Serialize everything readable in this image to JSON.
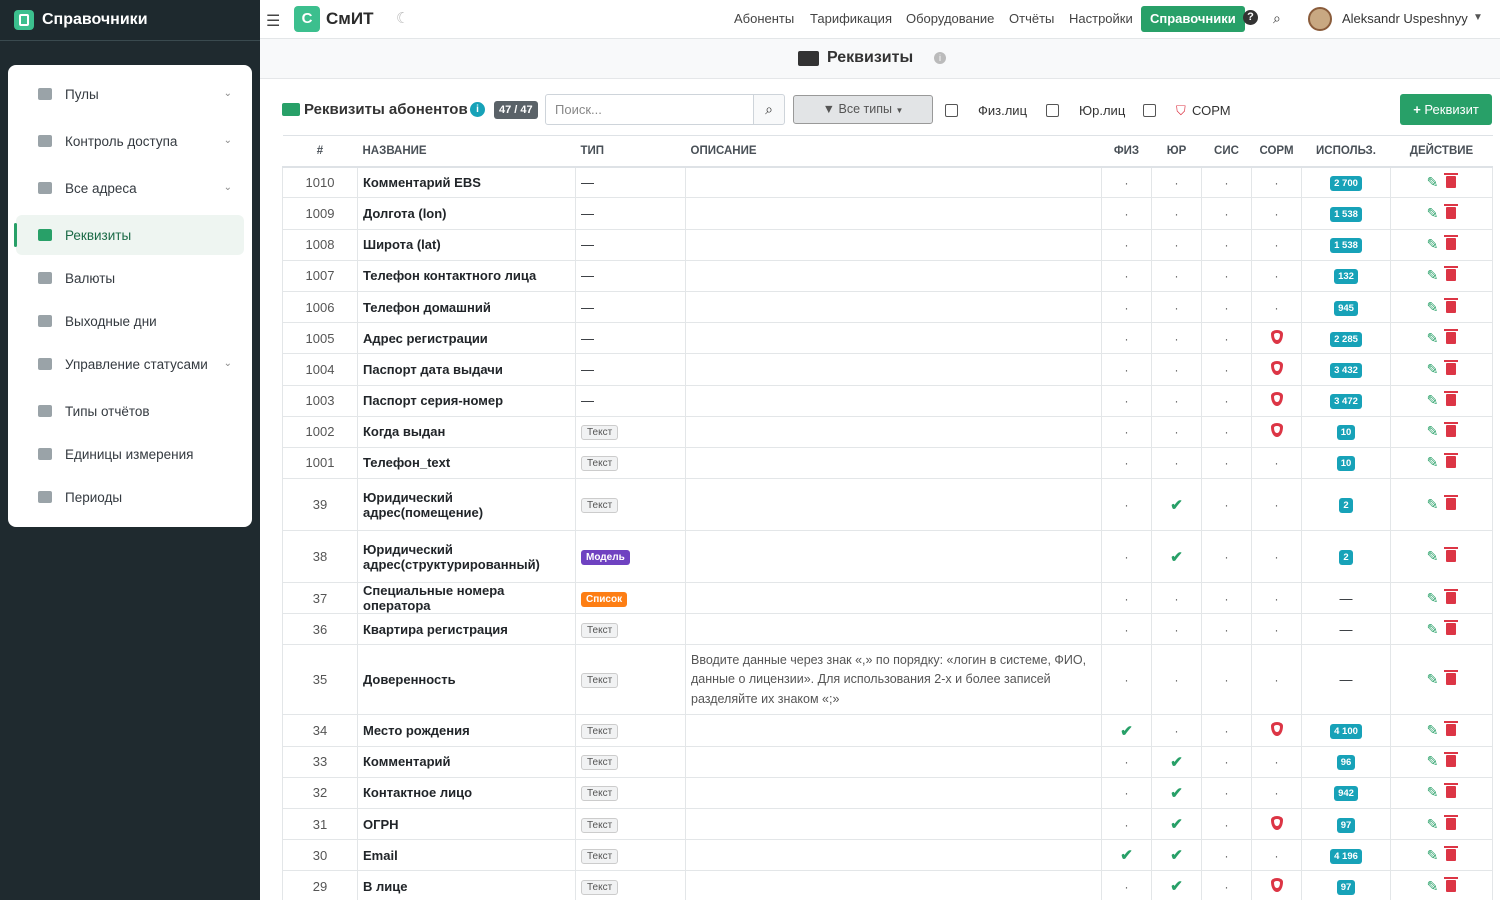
{
  "sidebar": {
    "brand": "Справочники",
    "items": [
      {
        "label": "Пулы",
        "caret": true,
        "active": false
      },
      {
        "label": "Контроль доступа",
        "caret": true,
        "active": false
      },
      {
        "label": "Все адреса",
        "caret": true,
        "active": false
      },
      {
        "label": "Реквизиты",
        "caret": false,
        "active": true
      },
      {
        "label": "Валюты",
        "caret": false,
        "active": false
      },
      {
        "label": "Выходные дни",
        "caret": false,
        "active": false
      },
      {
        "label": "Управление статусами",
        "caret": true,
        "active": false
      },
      {
        "label": "Типы отчётов",
        "caret": false,
        "active": false
      },
      {
        "label": "Единицы измерения",
        "caret": false,
        "active": false
      },
      {
        "label": "Периоды",
        "caret": false,
        "active": false
      }
    ]
  },
  "topbar": {
    "logo_letter": "С",
    "logo_text": "СмИТ",
    "nav": [
      "Абоненты",
      "Тарификация",
      "Оборудование",
      "Отчёты",
      "Настройки",
      "Справочники"
    ],
    "active_nav": "Справочники",
    "help": "?",
    "user": "Aleksandr Uspeshnyy"
  },
  "page": {
    "title": "Реквизиты",
    "info": "i"
  },
  "toolbar": {
    "title": "Реквизиты абонентов",
    "info": "i",
    "count": "47 / 47",
    "search_placeholder": "Поиск...",
    "filter_label": "Все типы",
    "cb_phys": "Физ.лиц",
    "cb_jur": "Юр.лиц",
    "cb_sorm": "СОРМ",
    "add_label": "Реквизит"
  },
  "table": {
    "headers": [
      "#",
      "НАЗВАНИЕ",
      "ТИП",
      "ОПИСАНИЕ",
      "ФИЗ",
      "ЮР",
      "СИС",
      "СОРМ",
      "ИСПОЛЬЗ.",
      "ДЕЙСТВИЕ"
    ],
    "rows": [
      {
        "id": "1010",
        "name": "Комментарий EBS",
        "type": "—",
        "desc": "",
        "fiz": "·",
        "jur": "·",
        "sis": "·",
        "sorm": "·",
        "used": "2 700"
      },
      {
        "id": "1009",
        "name": "Долгота (lon)",
        "type": "—",
        "desc": "",
        "fiz": "·",
        "jur": "·",
        "sis": "·",
        "sorm": "·",
        "used": "1 538"
      },
      {
        "id": "1008",
        "name": "Широта (lat)",
        "type": "—",
        "desc": "",
        "fiz": "·",
        "jur": "·",
        "sis": "·",
        "sorm": "·",
        "used": "1 538"
      },
      {
        "id": "1007",
        "name": "Телефон контактного лица",
        "type": "—",
        "desc": "",
        "fiz": "·",
        "jur": "·",
        "sis": "·",
        "sorm": "·",
        "used": "132"
      },
      {
        "id": "1006",
        "name": "Телефон домашний",
        "type": "—",
        "desc": "",
        "fiz": "·",
        "jur": "·",
        "sis": "·",
        "sorm": "·",
        "used": "945"
      },
      {
        "id": "1005",
        "name": "Адрес регистрации",
        "type": "—",
        "desc": "",
        "fiz": "·",
        "jur": "·",
        "sis": "·",
        "sorm": "shield",
        "used": "2 285"
      },
      {
        "id": "1004",
        "name": "Паспорт дата выдачи",
        "type": "—",
        "desc": "",
        "fiz": "·",
        "jur": "·",
        "sis": "·",
        "sorm": "shield",
        "used": "3 432"
      },
      {
        "id": "1003",
        "name": "Паспорт серия-номер",
        "type": "—",
        "desc": "",
        "fiz": "·",
        "jur": "·",
        "sis": "·",
        "sorm": "shield",
        "used": "3 472"
      },
      {
        "id": "1002",
        "name": "Когда выдан",
        "type": "Текст",
        "desc": "",
        "fiz": "·",
        "jur": "·",
        "sis": "·",
        "sorm": "shield",
        "used": "10"
      },
      {
        "id": "1001",
        "name": "Телефон_text",
        "type": "Текст",
        "desc": "",
        "fiz": "·",
        "jur": "·",
        "sis": "·",
        "sorm": "·",
        "used": "10"
      },
      {
        "id": "39",
        "name": "Юридический адрес(помещение)",
        "type": "Текст",
        "desc": "",
        "fiz": "·",
        "jur": "check",
        "sis": "·",
        "sorm": "·",
        "used": "2",
        "h": 52
      },
      {
        "id": "38",
        "name": "Юридический адрес(структурированный)",
        "type": "Модель",
        "desc": "",
        "fiz": "·",
        "jur": "check",
        "sis": "·",
        "sorm": "·",
        "used": "2",
        "h": 52
      },
      {
        "id": "37",
        "name": "Специальные номера оператора",
        "type": "Список",
        "desc": "",
        "fiz": "·",
        "jur": "·",
        "sis": "·",
        "sorm": "·",
        "used": "—"
      },
      {
        "id": "36",
        "name": "Квартира регистрация",
        "type": "Текст",
        "desc": "",
        "fiz": "·",
        "jur": "·",
        "sis": "·",
        "sorm": "·",
        "used": "—"
      },
      {
        "id": "35",
        "name": "Доверенность",
        "type": "Текст",
        "desc": "Вводите данные через знак «,» по порядку: «логин в системе, ФИО, данные о лицензии». Для использования 2-х и более записей разделяйте их знаком «;»",
        "fiz": "·",
        "jur": "·",
        "sis": "·",
        "sorm": "·",
        "used": "—",
        "h": 70
      },
      {
        "id": "34",
        "name": "Место рождения",
        "type": "Текст",
        "desc": "",
        "fiz": "check",
        "jur": "·",
        "sis": "·",
        "sorm": "shield",
        "used": "4 100"
      },
      {
        "id": "33",
        "name": "Комментарий",
        "type": "Текст",
        "desc": "",
        "fiz": "·",
        "jur": "check",
        "sis": "·",
        "sorm": "·",
        "used": "96"
      },
      {
        "id": "32",
        "name": "Контактное лицо",
        "type": "Текст",
        "desc": "",
        "fiz": "·",
        "jur": "check",
        "sis": "·",
        "sorm": "·",
        "used": "942"
      },
      {
        "id": "31",
        "name": "ОГРН",
        "type": "Текст",
        "desc": "",
        "fiz": "·",
        "jur": "check",
        "sis": "·",
        "sorm": "shield",
        "used": "97"
      },
      {
        "id": "30",
        "name": "Email",
        "type": "Текст",
        "desc": "",
        "fiz": "check",
        "jur": "check",
        "sis": "·",
        "sorm": "·",
        "used": "4 196"
      },
      {
        "id": "29",
        "name": "В лице",
        "type": "Текст",
        "desc": "",
        "fiz": "·",
        "jur": "check",
        "sis": "·",
        "sorm": "shield",
        "used": "97"
      }
    ]
  }
}
